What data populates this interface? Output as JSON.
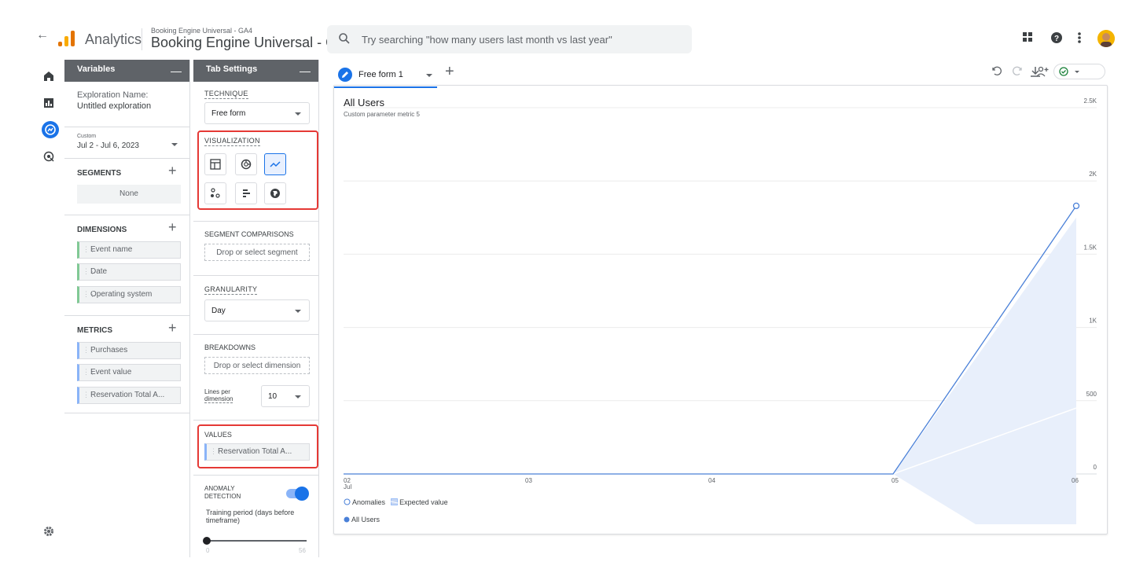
{
  "header": {
    "app_name": "Analytics",
    "property_small": "Booking Engine Universal - GA4",
    "property_big": "Booking Engine Universal - G...",
    "search_placeholder": "Try searching \"how many users last month vs last year\""
  },
  "variables": {
    "title": "Variables",
    "collapse_label": "—",
    "exploration_name_label": "Exploration Name:",
    "exploration_name": "Untitled exploration",
    "date_range_label": "Custom",
    "date_range": "Jul 2 - Jul 6, 2023",
    "segments_title": "SEGMENTS",
    "segments_none": "None",
    "dimensions_title": "DIMENSIONS",
    "dimensions": [
      "Event name",
      "Date",
      "Operating system"
    ],
    "metrics_title": "METRICS",
    "metrics": [
      "Purchases",
      "Event value",
      "Reservation Total A..."
    ]
  },
  "tab_settings": {
    "title": "Tab Settings",
    "collapse_label": "—",
    "technique_label": "TECHNIQUE",
    "technique_value": "Free form",
    "visualization_label": "VISUALIZATION",
    "segment_comparisons_label": "SEGMENT COMPARISONS",
    "segment_drop": "Drop or select segment",
    "granularity_label": "GRANULARITY",
    "granularity_value": "Day",
    "breakdowns_label": "BREAKDOWNS",
    "breakdown_drop": "Drop or select dimension",
    "lines_per_label_1": "Lines per",
    "lines_per_label_2": "dimension",
    "lines_per_value": "10",
    "values_label": "VALUES",
    "values_item": "Reservation Total A...",
    "anomaly_label_1": "ANOMALY",
    "anomaly_label_2": "DETECTION",
    "anomaly_enabled": true,
    "training_period_label": "Training period (days before timeframe)",
    "slider_min": "0",
    "slider_max": "56"
  },
  "tabs": {
    "active_tab": "Free form 1",
    "add_label": "+"
  },
  "chart_data": {
    "type": "line",
    "title": "All Users",
    "subtitle": "Custom parameter metric 5",
    "x": [
      "02\nJul",
      "03",
      "04",
      "05",
      "06"
    ],
    "x_labels": [
      "02",
      "03",
      "04",
      "05",
      "06"
    ],
    "x_month_label": "Jul",
    "y_ticks": [
      "0",
      "500",
      "1K",
      "1.5K",
      "2K",
      "2.5K"
    ],
    "ylim": [
      0,
      2500
    ],
    "series": [
      {
        "name": "All Users",
        "values": [
          0,
          0,
          0,
          0,
          1830
        ],
        "color": "#4a80d8"
      }
    ],
    "expected_band": {
      "x_start_index": 3,
      "upper_end": 1750,
      "lower_end": -350,
      "mid_end": 450
    },
    "anomaly_points": [
      4
    ],
    "legend": {
      "anomalies": "Anomalies",
      "expected": "Expected value",
      "series": "All Users"
    },
    "grid": true
  },
  "colors": {
    "accent": "#1a73e8",
    "highlight_box": "#e53935",
    "line": "#4a80d8",
    "band": "#e8effb"
  }
}
